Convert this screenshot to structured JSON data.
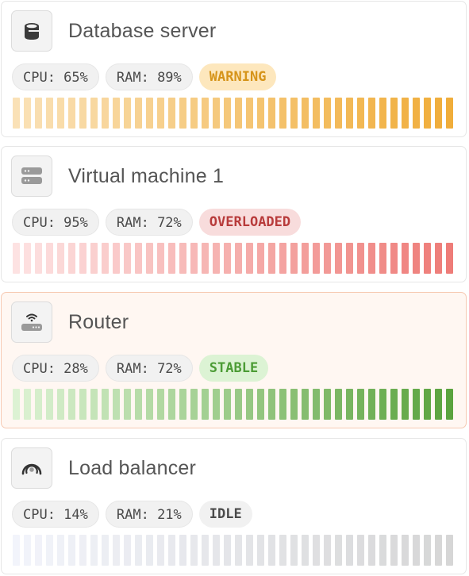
{
  "servers": [
    {
      "name": "Database server",
      "icon": "database-icon",
      "cpu": "CPU: 65%",
      "ram": "RAM: 89%",
      "status": "WARNING",
      "status_color": "#d6941a",
      "status_bg": "#fde7bd",
      "bar_from": "#fae1b6",
      "bar_to": "#f0ad3a",
      "active": false
    },
    {
      "name": "Virtual machine 1",
      "icon": "server-icon",
      "cpu": "CPU: 95%",
      "ram": "RAM: 72%",
      "status": "OVERLOADED",
      "status_color": "#b83b3b",
      "status_bg": "#f8dcdc",
      "bar_from": "#fde2e2",
      "bar_to": "#ee7c78",
      "active": false
    },
    {
      "name": "Router",
      "icon": "router-icon",
      "cpu": "CPU: 28%",
      "ram": "RAM: 72%",
      "status": "STABLE",
      "status_color": "#4c9c35",
      "status_bg": "#dcf3d4",
      "bar_from": "#dcf2d3",
      "bar_to": "#5aa33e",
      "active": true
    },
    {
      "name": "Load balancer",
      "icon": "load-balancer-icon",
      "cpu": "CPU: 14%",
      "ram": "RAM: 21%",
      "status": "IDLE",
      "status_color": "#4a4a4a",
      "status_bg": "#f1f1f1",
      "bar_from": "#f2f4fb",
      "bar_to": "#d6d6d6",
      "active": false
    }
  ]
}
